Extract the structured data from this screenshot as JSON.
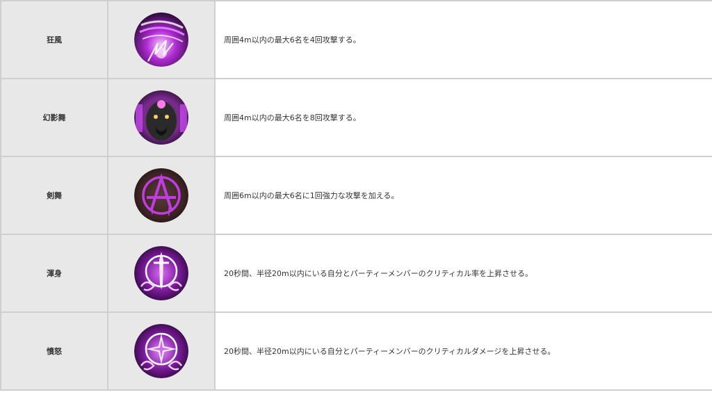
{
  "skills": [
    {
      "name": "狂風",
      "icon": "whirlwind-claw-icon",
      "description": "周囲4m以内の最大6名を4回攻撃する。"
    },
    {
      "name": "幻影舞",
      "icon": "phantom-demon-icon",
      "description": "周囲4m以内の最大6名を8回攻撃する。"
    },
    {
      "name": "剣舞",
      "icon": "anarchy-sigil-icon",
      "description": "周囲6m以内の最大6名に1回強力な攻撃を加える。"
    },
    {
      "name": "渾身",
      "icon": "sword-crest-icon",
      "description": "20秒間、半径20m以内にいる自分とパーティーメンバーのクリティカル率を上昇させる。"
    },
    {
      "name": "憤怒",
      "icon": "star-crest-icon",
      "description": "20秒間、半径20m以内にいる自分とパーティーメンバーのクリティカルダメージを上昇させる。"
    }
  ],
  "colors": {
    "cell_gray": "#e8e8e8",
    "border": "#cfcfcf",
    "accent_purple": "#c23de0"
  }
}
